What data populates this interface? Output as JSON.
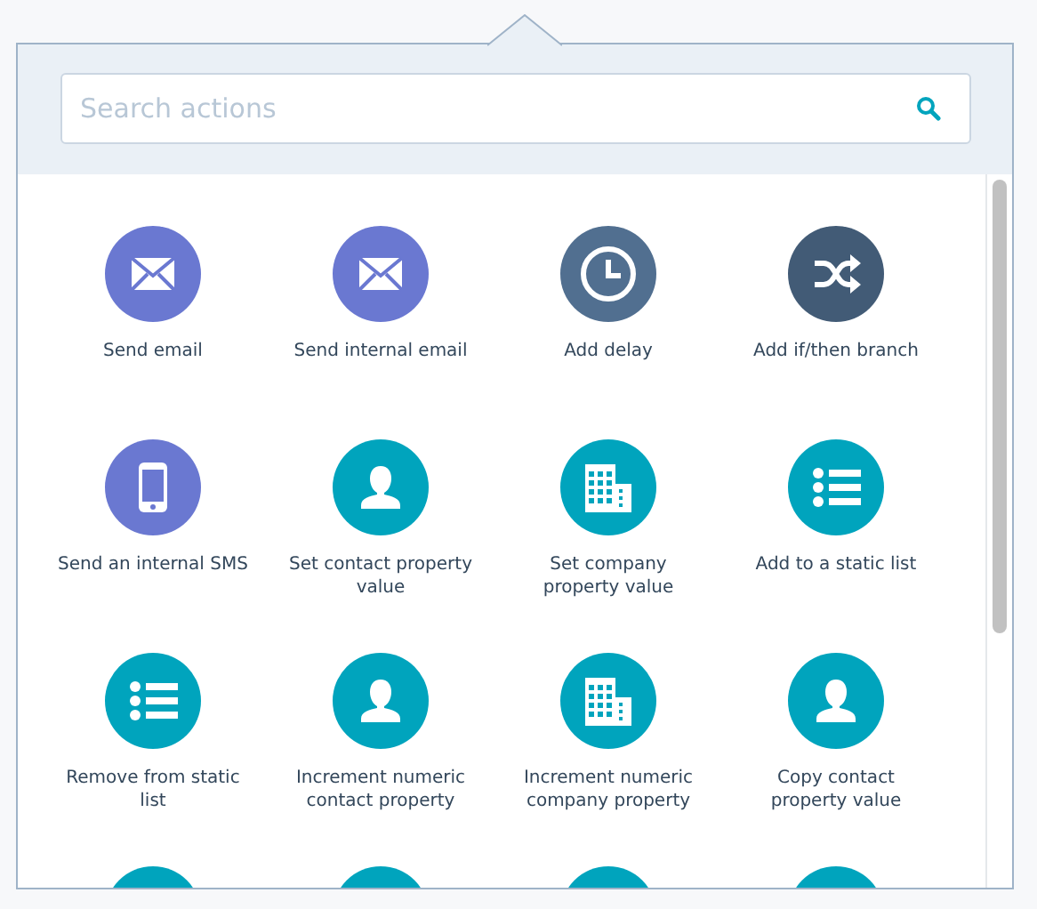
{
  "search": {
    "placeholder": "Search actions"
  },
  "actions": [
    {
      "label": "Send email",
      "kind": "envelope",
      "color": "#6a78d1"
    },
    {
      "label": "Send internal email",
      "kind": "envelope",
      "color": "#6a78d1"
    },
    {
      "label": "Add delay",
      "kind": "clock",
      "color": "#516f90"
    },
    {
      "label": "Add if/then branch",
      "kind": "shuffle",
      "color": "#425b76"
    },
    {
      "label": "Send an internal SMS",
      "kind": "phone",
      "color": "#6a78d1"
    },
    {
      "label": "Set contact property value",
      "kind": "person",
      "color": "#00a4bd"
    },
    {
      "label": "Set company property value",
      "kind": "building",
      "color": "#00a4bd"
    },
    {
      "label": "Add to a static list",
      "kind": "list",
      "color": "#00a4bd"
    },
    {
      "label": "Remove from static list",
      "kind": "list",
      "color": "#00a4bd"
    },
    {
      "label": "Increment numeric contact property",
      "kind": "person",
      "color": "#00a4bd"
    },
    {
      "label": "Increment numeric company property",
      "kind": "building",
      "color": "#00a4bd"
    },
    {
      "label": "Copy contact property value",
      "kind": "person",
      "color": "#00a4bd"
    },
    {
      "kind": "blank",
      "color": "#00a4bd"
    },
    {
      "kind": "blank",
      "color": "#00a4bd"
    },
    {
      "kind": "blank",
      "color": "#00a4bd"
    },
    {
      "kind": "blank",
      "color": "#00a4bd"
    }
  ]
}
